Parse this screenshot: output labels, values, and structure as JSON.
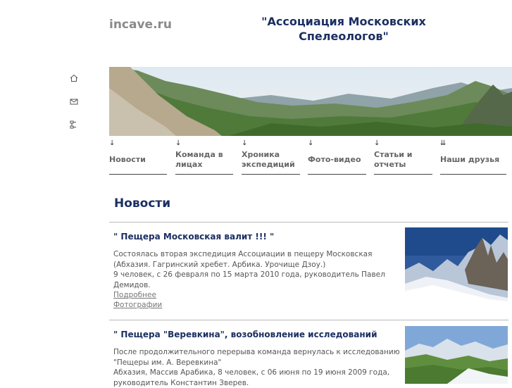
{
  "header": {
    "site_name": "incave.ru",
    "title_line1": "\"Ассоциация Московских",
    "title_line2": "Спелеологов\""
  },
  "side_icons": [
    "home-icon",
    "mail-icon",
    "sitemap-icon"
  ],
  "nav": {
    "items": [
      {
        "arrow": "↓",
        "label_line1": "Новости",
        "label_line2": ""
      },
      {
        "arrow": "↓",
        "label_line1": "Команда в",
        "label_line2": "лицах"
      },
      {
        "arrow": "↓",
        "label_line1": "Хроника",
        "label_line2": "экспедиций"
      },
      {
        "arrow": "↓",
        "label_line1": "Фото-видео",
        "label_line2": ""
      },
      {
        "arrow": "↓",
        "label_line1": "Статьи и",
        "label_line2": "отчеты"
      },
      {
        "arrow": "⇊",
        "label_line1": "Наши друзья",
        "label_line2": ""
      }
    ]
  },
  "main": {
    "heading": "Новости",
    "news": [
      {
        "title": "\" Пещера Московская валит !!! \"",
        "lines": [
          "Состоялась вторая экспедиция Ассоциации в пещеру Московская",
          "(Абхазия. Гагринский хребет. Арбика. Урочище Дзоу.)",
          "9 человек, с 26 февраля по 15 марта 2010 года, руководитель Павел",
          "Демидов."
        ],
        "more_link": "Подробнее",
        "photos_link": "Фотографии"
      },
      {
        "title": "\" Пещера \"Веревкина\", возобновление исследований",
        "lines": [
          "После продолжительного перерыва команда вернулась к исследованию",
          "\"Пещеры им. А. Веревкина\"",
          "Абхазия, Массив Арабика, 8 человек, с 06 июня по 19 июня 2009 года,",
          "руководитель Константин Зверев."
        ]
      }
    ]
  },
  "colors": {
    "title": "#1c2f62",
    "site_name": "#8a8a8a",
    "nav_text": "#666666"
  }
}
